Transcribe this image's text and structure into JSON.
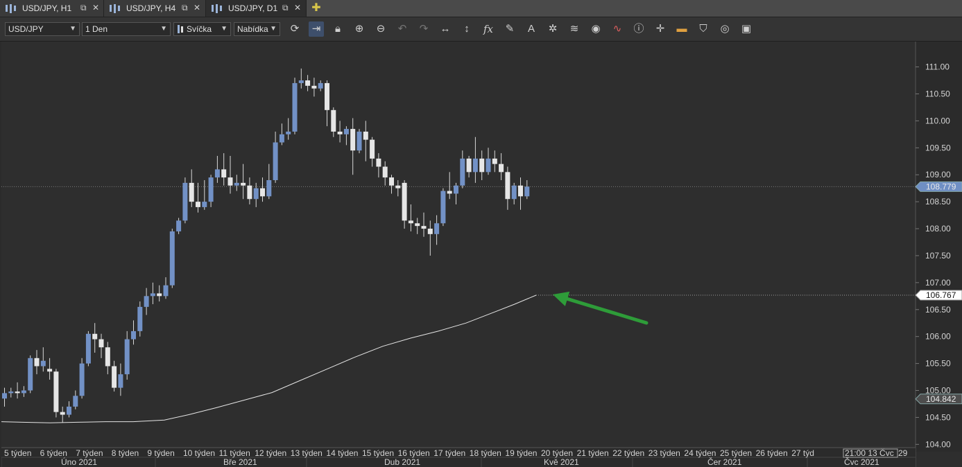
{
  "tabs": [
    {
      "label": "USD/JPY, H1",
      "active": false
    },
    {
      "label": "USD/JPY, H4",
      "active": false
    },
    {
      "label": "USD/JPY, D1",
      "active": true
    }
  ],
  "toolbar": {
    "instrument": "USD/JPY",
    "period": "1 Den",
    "chart_type": "Svíčka",
    "price_side": "Nabídka",
    "icons": [
      "refresh-icon",
      "autoscroll-icon",
      "lock-icon",
      "zoom-in-icon",
      "zoom-out-icon",
      "undo-icon",
      "redo-icon",
      "horizontal-scale-icon",
      "vertical-scale-icon",
      "indicator-fx-icon",
      "pencil-icon",
      "text-tool-icon",
      "pattern-icon",
      "layers-icon",
      "eye-icon",
      "signal-icon",
      "info-icon",
      "crosshair-icon",
      "color-bar-icon",
      "paint-bucket-icon",
      "circle-icon",
      "save-icon"
    ]
  },
  "chart_data": {
    "type": "candlestick",
    "instrument": "USD/JPY",
    "timeframe": "D1",
    "y_ticks": [
      "111.00",
      "110.50",
      "110.00",
      "109.50",
      "109.00",
      "108.50",
      "108.00",
      "107.50",
      "107.00",
      "106.50",
      "106.00",
      "105.50",
      "105.00",
      "104.50",
      "104.00"
    ],
    "ylim": [
      103.94,
      111.47
    ],
    "price_labels": [
      {
        "value": 108.779,
        "text": "108.779",
        "color": "#6f8fc4"
      },
      {
        "value": 106.767,
        "text": "106.767",
        "color": "#ffffff"
      },
      {
        "value": 104.842,
        "text": "104.842",
        "color": "#4d4d4d"
      }
    ],
    "week_labels": [
      "5 týden",
      "6 týden",
      "7 týden",
      "8 týden",
      "9 týden",
      "10 týden",
      "11 týden",
      "12 týden",
      "13 týden",
      "14 týden",
      "15 týden",
      "16 týden",
      "17 týden",
      "18 týden",
      "19 týden",
      "20 týden",
      "21 týden",
      "22 týden",
      "23 týden",
      "24 týden",
      "25 týden",
      "26 týden",
      "27 týd",
      "21:00 13 Čvc",
      "29"
    ],
    "month_labels": [
      "Úno 2021",
      "Bře 2021",
      "Dub 2021",
      "Kvě 2021",
      "Čer 2021",
      "Čvc 2021"
    ],
    "candles": [
      [
        104.85,
        104.95,
        104.7,
        105.05
      ],
      [
        104.95,
        104.98,
        104.87,
        105.05
      ],
      [
        104.98,
        104.95,
        104.85,
        105.15
      ],
      [
        104.95,
        105.0,
        104.88,
        105.08
      ],
      [
        105.0,
        105.6,
        104.95,
        105.65
      ],
      [
        105.6,
        105.45,
        105.3,
        105.75
      ],
      [
        105.45,
        105.55,
        105.35,
        105.8
      ],
      [
        105.4,
        105.35,
        105.2,
        105.6
      ],
      [
        105.35,
        104.6,
        104.5,
        105.4
      ],
      [
        104.6,
        104.55,
        104.4,
        104.7
      ],
      [
        104.55,
        104.7,
        104.5,
        104.8
      ],
      [
        104.7,
        104.9,
        104.65,
        105.0
      ],
      [
        104.9,
        105.5,
        104.85,
        105.6
      ],
      [
        105.5,
        106.05,
        105.45,
        106.1
      ],
      [
        106.05,
        105.95,
        105.7,
        106.25
      ],
      [
        105.95,
        105.8,
        105.6,
        106.05
      ],
      [
        105.8,
        105.45,
        105.3,
        105.9
      ],
      [
        105.45,
        105.05,
        104.98,
        105.55
      ],
      [
        105.05,
        105.3,
        104.9,
        105.5
      ],
      [
        105.3,
        105.95,
        105.2,
        106.1
      ],
      [
        105.95,
        106.1,
        105.85,
        106.3
      ],
      [
        106.1,
        106.55,
        106.0,
        106.65
      ],
      [
        106.55,
        106.75,
        106.4,
        106.9
      ],
      [
        106.75,
        106.8,
        106.6,
        107.0
      ],
      [
        106.8,
        106.75,
        106.65,
        106.95
      ],
      [
        106.75,
        106.95,
        106.7,
        107.1
      ],
      [
        106.95,
        107.95,
        106.9,
        108.0
      ],
      [
        107.95,
        108.15,
        107.9,
        108.2
      ],
      [
        108.15,
        108.85,
        108.1,
        108.95
      ],
      [
        108.85,
        108.5,
        108.4,
        109.1
      ],
      [
        108.5,
        108.4,
        108.3,
        108.85
      ],
      [
        108.4,
        108.5,
        108.35,
        108.9
      ],
      [
        108.5,
        108.95,
        108.4,
        109.0
      ],
      [
        108.95,
        109.1,
        108.85,
        109.35
      ],
      [
        109.1,
        108.95,
        108.8,
        109.4
      ],
      [
        108.95,
        108.8,
        108.65,
        109.35
      ],
      [
        108.8,
        108.85,
        108.7,
        109.0
      ],
      [
        108.85,
        108.8,
        108.55,
        109.2
      ],
      [
        108.8,
        108.55,
        108.45,
        108.95
      ],
      [
        108.55,
        108.75,
        108.4,
        108.85
      ],
      [
        108.75,
        108.6,
        108.5,
        108.95
      ],
      [
        108.6,
        108.9,
        108.55,
        109.2
      ],
      [
        108.9,
        109.6,
        108.85,
        109.8
      ],
      [
        109.6,
        109.75,
        109.55,
        109.95
      ],
      [
        109.75,
        109.8,
        109.65,
        110.05
      ],
      [
        109.8,
        110.7,
        109.75,
        110.8
      ],
      [
        110.7,
        110.75,
        110.6,
        110.97
      ],
      [
        110.75,
        110.65,
        110.55,
        110.85
      ],
      [
        110.65,
        110.6,
        110.45,
        110.8
      ],
      [
        110.6,
        110.7,
        110.55,
        110.75
      ],
      [
        110.7,
        110.2,
        109.9,
        110.75
      ],
      [
        110.2,
        109.8,
        109.7,
        110.25
      ],
      [
        109.8,
        109.75,
        109.6,
        110.0
      ],
      [
        109.75,
        109.85,
        109.55,
        109.9
      ],
      [
        109.85,
        109.45,
        109.0,
        110.05
      ],
      [
        109.45,
        109.8,
        109.4,
        109.85
      ],
      [
        109.8,
        109.65,
        109.25,
        110.0
      ],
      [
        109.65,
        109.3,
        109.15,
        109.7
      ],
      [
        109.3,
        109.15,
        108.95,
        109.4
      ],
      [
        109.15,
        108.95,
        108.8,
        109.25
      ],
      [
        108.95,
        108.8,
        108.65,
        109.0
      ],
      [
        108.8,
        108.75,
        108.6,
        108.9
      ],
      [
        108.85,
        108.15,
        108.0,
        108.9
      ],
      [
        108.15,
        108.1,
        107.95,
        108.45
      ],
      [
        108.1,
        108.05,
        107.9,
        108.2
      ],
      [
        108.05,
        108.0,
        107.85,
        108.3
      ],
      [
        108.0,
        107.9,
        107.5,
        108.15
      ],
      [
        107.9,
        108.1,
        107.7,
        108.25
      ],
      [
        108.1,
        108.7,
        108.05,
        108.75
      ],
      [
        108.7,
        108.65,
        108.55,
        109.05
      ],
      [
        108.65,
        108.8,
        108.45,
        108.85
      ],
      [
        108.8,
        109.3,
        108.75,
        109.45
      ],
      [
        109.3,
        109.05,
        108.95,
        109.35
      ],
      [
        109.05,
        109.3,
        108.85,
        109.7
      ],
      [
        109.3,
        109.05,
        108.9,
        109.45
      ],
      [
        109.05,
        109.3,
        109.0,
        109.5
      ],
      [
        109.3,
        109.2,
        109.05,
        109.45
      ],
      [
        109.2,
        109.05,
        108.9,
        109.4
      ],
      [
        109.05,
        108.55,
        108.35,
        109.15
      ],
      [
        108.55,
        108.8,
        108.45,
        108.85
      ],
      [
        108.8,
        108.6,
        108.35,
        108.95
      ],
      [
        108.6,
        108.78,
        108.55,
        108.9
      ]
    ],
    "ma_line": [
      [
        0,
        104.42
      ],
      [
        30,
        104.41
      ],
      [
        70,
        104.4
      ],
      [
        110,
        104.41
      ],
      [
        150,
        104.42
      ],
      [
        190,
        104.42
      ],
      [
        235,
        104.45
      ],
      [
        270,
        104.55
      ],
      [
        310,
        104.68
      ],
      [
        350,
        104.82
      ],
      [
        390,
        104.96
      ],
      [
        430,
        105.18
      ],
      [
        470,
        105.4
      ],
      [
        510,
        105.62
      ],
      [
        550,
        105.82
      ],
      [
        590,
        105.97
      ],
      [
        630,
        106.1
      ],
      [
        670,
        106.25
      ],
      [
        710,
        106.45
      ],
      [
        740,
        106.6
      ],
      [
        771,
        106.767
      ]
    ],
    "arrow": {
      "from": [
        930,
        466
      ],
      "to": [
        795,
        425
      ],
      "color": "#2e9c39"
    }
  }
}
